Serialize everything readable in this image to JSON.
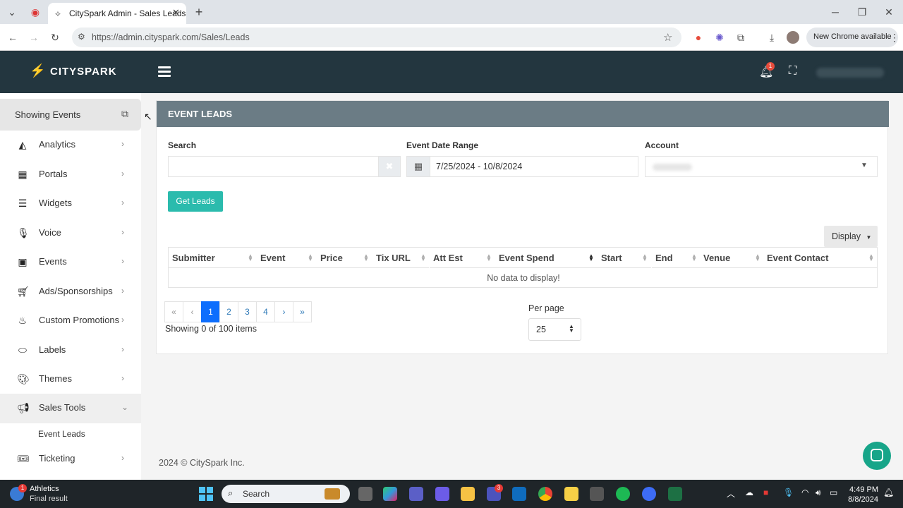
{
  "browser": {
    "tab_title": "CitySpark Admin - Sales Leads",
    "url": "https://admin.cityspark.com/Sales/Leads",
    "new_chrome_label": "New Chrome available"
  },
  "header": {
    "logo_text": "CITYSPARK",
    "notification_count": "1"
  },
  "sidebar": {
    "showing_label": "Showing Events",
    "items": [
      {
        "label": "Analytics",
        "icon": "area-chart-icon"
      },
      {
        "label": "Portals",
        "icon": "calendar-icon"
      },
      {
        "label": "Widgets",
        "icon": "list-icon"
      },
      {
        "label": "Voice",
        "icon": "microphone-icon"
      },
      {
        "label": "Events",
        "icon": "calendar-check-icon"
      },
      {
        "label": "Ads/Sponsorships",
        "icon": "cart-icon"
      },
      {
        "label": "Custom Promotions",
        "icon": "fire-icon"
      },
      {
        "label": "Labels",
        "icon": "tag-icon"
      },
      {
        "label": "Themes",
        "icon": "palette-icon"
      },
      {
        "label": "Sales Tools",
        "icon": "megaphone-icon"
      },
      {
        "label": "Ticketing",
        "icon": "ticket-icon"
      }
    ],
    "sub_item": "Event Leads"
  },
  "panel": {
    "title": "EVENT LEADS",
    "search_label": "Search",
    "search_value": "",
    "date_label": "Event Date Range",
    "date_value": "7/25/2024 - 10/8/2024",
    "account_label": "Account",
    "get_leads_label": "Get Leads",
    "display_label": "Display",
    "columns": [
      "Submitter",
      "Event",
      "Price",
      "Tix URL",
      "Att Est",
      "Event Spend",
      "Start",
      "End",
      "Venue",
      "Event Contact"
    ],
    "no_data": "No data to display!",
    "pages": [
      "«",
      "‹",
      "1",
      "2",
      "3",
      "4",
      "›",
      "»"
    ],
    "showing_count": "Showing 0 of 100 items",
    "per_page_label": "Per page",
    "per_page_value": "25"
  },
  "footer": {
    "copyright": "2024 © CitySpark Inc."
  },
  "taskbar": {
    "weather_title": "Athletics",
    "weather_sub": "Final result",
    "search_placeholder": "Search",
    "time": "4:49 PM",
    "date": "8/8/2024",
    "teams_badge": "3"
  },
  "colors": {
    "header_bg": "#23363f",
    "panel_head_bg": "#6b7c85",
    "accent": "#2bbbad",
    "active_page": "#0d6efd"
  }
}
